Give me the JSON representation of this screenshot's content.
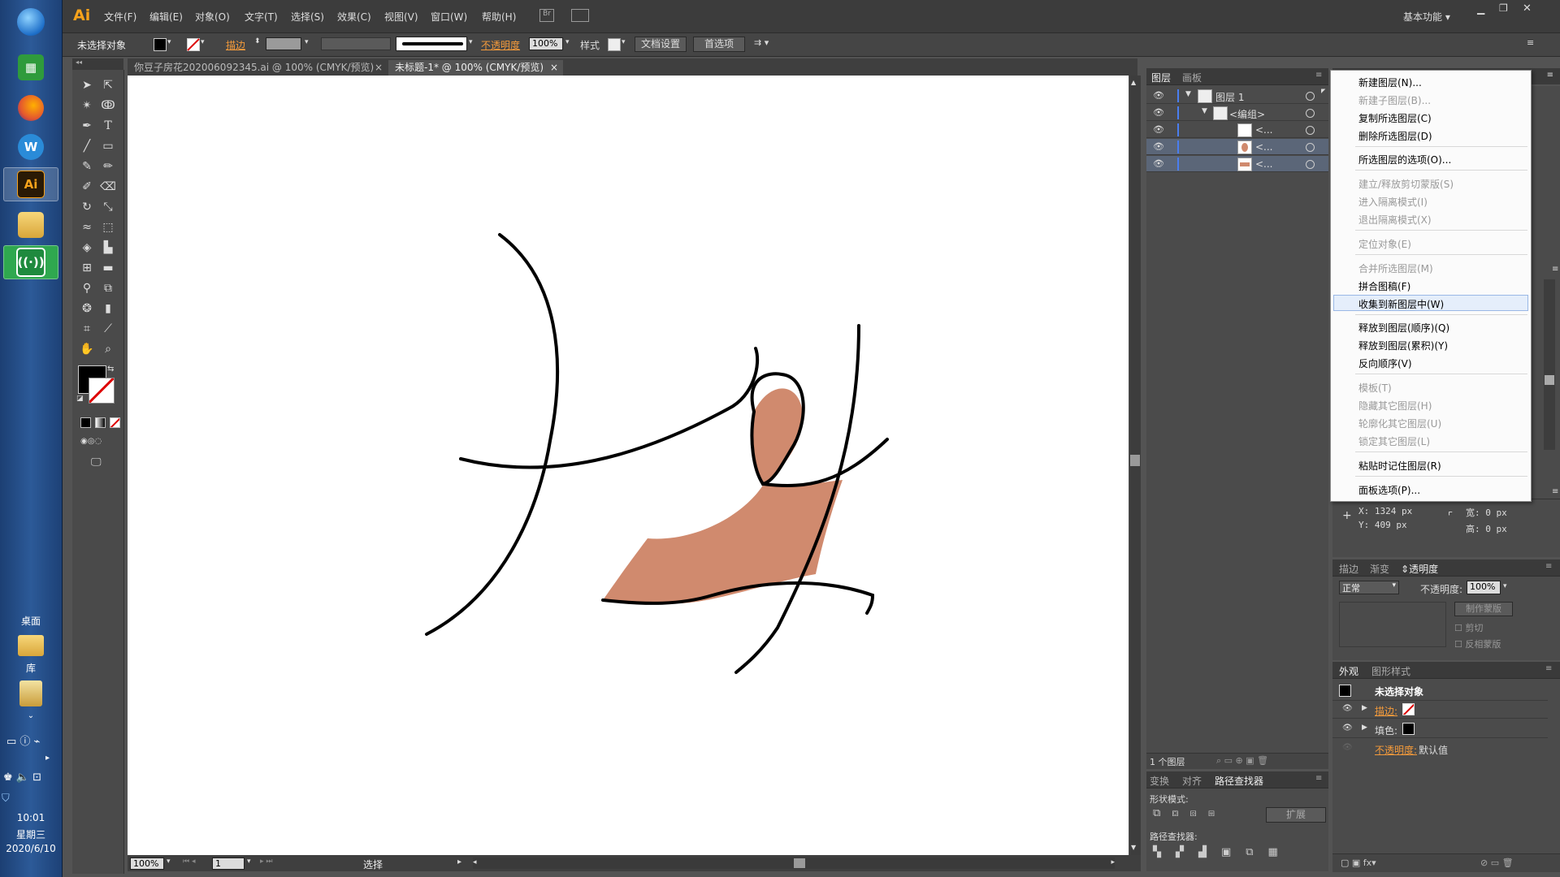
{
  "taskbar": {
    "desktop_label": "桌面",
    "library_label": "库",
    "time": "10:01",
    "weekday": "星期三",
    "date": "2020/6/10",
    "ai_label": "Ai",
    "wps_label": "W"
  },
  "app": {
    "logo": "Ai",
    "menus": [
      "文件(F)",
      "编辑(E)",
      "对象(O)",
      "文字(T)",
      "选择(S)",
      "效果(C)",
      "视图(V)",
      "窗口(W)",
      "帮助(H)"
    ],
    "workspace": "基本功能",
    "colors": {
      "accent": "#f59b3b",
      "bg": "#535353",
      "fill_shape": "#d08a6e"
    }
  },
  "control": {
    "no_selection": "未选择对象",
    "stroke_label": "描边",
    "opacity_label": "不透明度",
    "opacity_value": "100%",
    "style_label": "样式",
    "doc_setup": "文档设置",
    "preferences": "首选项"
  },
  "tabs": [
    {
      "label": "你豆子房花202006092345.ai @ 100% (CMYK/预览)",
      "close": "×"
    },
    {
      "label": "未标题-1* @ 100% (CMYK/预览)",
      "close": "×"
    }
  ],
  "status": {
    "zoom": "100%",
    "page": "1",
    "tool": "选择"
  },
  "layers_panel": {
    "tabs": [
      "图层",
      "画板"
    ],
    "rows": [
      {
        "name": "图层 1"
      },
      {
        "name": "<编组>"
      },
      {
        "name": "<..."
      },
      {
        "name": "<..."
      },
      {
        "name": "<..."
      }
    ],
    "footer": "1 个图层"
  },
  "context_menu": {
    "items": [
      {
        "label": "新建图层(N)...",
        "enabled": true
      },
      {
        "label": "新建子图层(B)...",
        "enabled": false
      },
      {
        "label": "复制所选图层(C)",
        "enabled": true
      },
      {
        "label": "删除所选图层(D)",
        "enabled": true
      },
      {
        "label": "所选图层的选项(O)...",
        "enabled": true
      },
      {
        "label": "建立/释放剪切蒙版(S)",
        "enabled": false
      },
      {
        "label": "进入隔离模式(I)",
        "enabled": false
      },
      {
        "label": "退出隔离模式(X)",
        "enabled": false
      },
      {
        "label": "定位对象(E)",
        "enabled": false
      },
      {
        "label": "合并所选图层(M)",
        "enabled": false
      },
      {
        "label": "拼合图稿(F)",
        "enabled": true
      },
      {
        "label": "收集到新图层中(W)",
        "enabled": true
      },
      {
        "label": "释放到图层(顺序)(Q)",
        "enabled": true
      },
      {
        "label": "释放到图层(累积)(Y)",
        "enabled": true
      },
      {
        "label": "反向顺序(V)",
        "enabled": true
      },
      {
        "label": "模板(T)",
        "enabled": false
      },
      {
        "label": "隐藏其它图层(H)",
        "enabled": false
      },
      {
        "label": "轮廓化其它图层(U)",
        "enabled": false
      },
      {
        "label": "锁定其它图层(L)",
        "enabled": false
      },
      {
        "label": "粘贴时记住图层(R)",
        "enabled": true
      },
      {
        "label": "面板选项(P)...",
        "enabled": true
      }
    ]
  },
  "info": {
    "x": "X: 1324 px",
    "y": "Y: 409 px",
    "w_label": "宽:",
    "w": "0 px",
    "h_label": "高:",
    "h": "0 px"
  },
  "transparency_panel": {
    "tabs": [
      "描边",
      "渐变",
      "透明度"
    ],
    "blend_mode": "正常",
    "opacity_label": "不透明度:",
    "opacity_value": "100%",
    "make_mask": "制作蒙版",
    "clip": "剪切",
    "invert": "反相蒙版"
  },
  "appearance_panel": {
    "tabs": [
      "外观",
      "图形样式"
    ],
    "title": "未选择对象",
    "stroke": "描边:",
    "fill": "填色:",
    "opacity": "不透明度:",
    "opacity_value": "默认值"
  },
  "pathfinder_panel": {
    "tabs": [
      "变换",
      "对齐",
      "路径查找器"
    ],
    "shape_modes": "形状模式:",
    "expand": "扩展",
    "pathfinders": "路径查找器:"
  }
}
